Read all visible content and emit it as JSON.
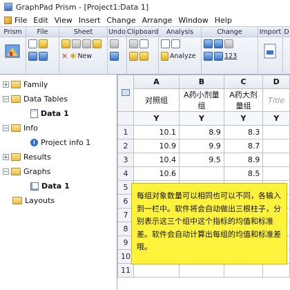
{
  "window": {
    "title": "GraphPad Prism - [Project1:Data 1]"
  },
  "menu": [
    "File",
    "Edit",
    "View",
    "Insert",
    "Change",
    "Arrange",
    "Window",
    "Help"
  ],
  "ribbon": {
    "groups": [
      "Prism",
      "File",
      "Sheet",
      "Undo",
      "Clipboard",
      "Analysis",
      "Change",
      "Import",
      "D"
    ],
    "sheet_new_label": "New",
    "analyze_label": "Analyze",
    "change_num_label": "123"
  },
  "tree": {
    "family": "Family",
    "data_tables": "Data Tables",
    "data1": "Data 1",
    "info": "Info",
    "project_info": "Project info 1",
    "results": "Results",
    "graphs": "Graphs",
    "graph_data1": "Data 1",
    "layouts": "Layouts"
  },
  "table": {
    "col_letters": [
      "A",
      "B",
      "C",
      "D"
    ],
    "col_titles": [
      "对照组",
      "A药小剂量组",
      "A药大剂量组",
      "Title"
    ],
    "y_label": "Y",
    "rows": [
      {
        "n": "1",
        "a": "10.1",
        "b": "8.9",
        "c": "8.3"
      },
      {
        "n": "2",
        "a": "10.9",
        "b": "9.9",
        "c": "8.7"
      },
      {
        "n": "3",
        "a": "10.4",
        "b": "9.5",
        "c": "8.9"
      },
      {
        "n": "4",
        "a": "10.6",
        "b": "",
        "c": "8.5"
      },
      {
        "n": "5",
        "a": "",
        "b": "",
        "c": ""
      },
      {
        "n": "6",
        "a": "",
        "b": "",
        "c": ""
      },
      {
        "n": "7",
        "a": "",
        "b": "",
        "c": ""
      },
      {
        "n": "8",
        "a": "",
        "b": "",
        "c": ""
      },
      {
        "n": "9",
        "a": "",
        "b": "",
        "c": ""
      },
      {
        "n": "10",
        "a": "",
        "b": "",
        "c": ""
      },
      {
        "n": "11",
        "a": "",
        "b": "",
        "c": ""
      }
    ]
  },
  "note": "每组对象数量可以相同也可以不同，各输入到一栏中。软件将会自动做出三根柱子，分别表示这三个组中这个指标的均值和标准差。软件会自动计算出每组的均值和标准差哦。",
  "colors": {
    "note_bg": "#fef33c",
    "accent": "#3d72c6"
  }
}
